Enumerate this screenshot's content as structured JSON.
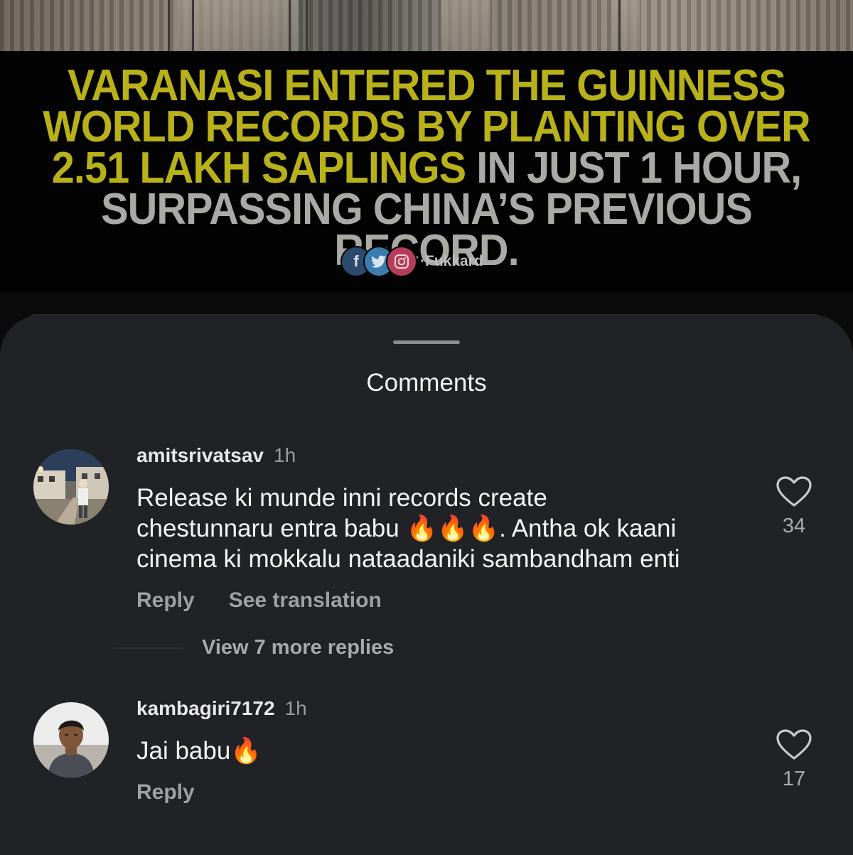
{
  "post": {
    "headline_yellow_1": "VARANASI ENTERED THE GUINNESS",
    "headline_yellow_2": "WORLD RECORDS BY PLANTING OVER",
    "headline_yellow_3": "2.51 LAKH SAPLINGS",
    "headline_gray_3": " IN JUST 1 HOUR,",
    "headline_gray_4": "SURPASSING CHINA’S PREVIOUS RECORD.",
    "social_fb": "f",
    "watermark": "·Fukkard"
  },
  "sheet": {
    "title": "Comments"
  },
  "comments": [
    {
      "username": "amitsrivatsav",
      "time": "1h",
      "text": "Release ki munde inni records create\nchestunnaru entra babu 🔥🔥🔥. Antha ok kaani\ncinema ki mokkalu nataadaniki sambandham enti",
      "reply_label": "Reply",
      "translate_label": "See translation",
      "like_count": "34",
      "view_replies": "View 7 more replies"
    },
    {
      "username": "kambagiri7172",
      "time": "1h",
      "text": "Jai babu🔥",
      "reply_label": "Reply",
      "like_count": "17"
    }
  ],
  "icons": {
    "like": "heart-outline-icon",
    "facebook": "facebook-icon",
    "twitter": "twitter-icon",
    "instagram": "instagram-icon"
  },
  "colors": {
    "sheet_bg": "#212225",
    "headline_yellow": "#b8b11a",
    "headline_gray": "#a9a9a6",
    "muted_text": "#9fa0a5"
  }
}
